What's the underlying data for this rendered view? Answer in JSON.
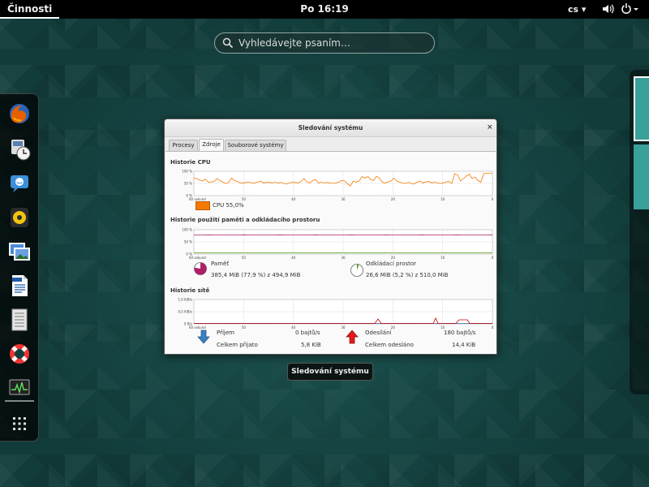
{
  "topbar": {
    "activities": "Činnosti",
    "clock": "Po 16:19",
    "language": "cs ▾",
    "volume_icon": "volume-icon",
    "power_icon": "power-icon"
  },
  "search": {
    "placeholder": "Vyhledávejte psaním…"
  },
  "dash": {
    "apps": [
      {
        "name": "firefox-icon"
      },
      {
        "name": "clock-app-icon"
      },
      {
        "name": "chat-app-icon"
      },
      {
        "name": "music-app-icon"
      },
      {
        "name": "photos-app-icon"
      },
      {
        "name": "writer-doc-icon"
      },
      {
        "name": "archive-app-icon"
      },
      {
        "name": "help-lifebuoy-icon"
      },
      {
        "name": "system-monitor-icon"
      },
      {
        "name": "show-apps-grid-icon"
      }
    ]
  },
  "window": {
    "title": "Sledování systému",
    "close": "×",
    "tabs": [
      "Procesy",
      "Zdroje",
      "Souborové systémy"
    ],
    "active_tab": "Zdroje",
    "cpu": {
      "title": "Historie CPU",
      "y_ticks": [
        "100 %",
        "50 %",
        "0 %"
      ],
      "x_ticks": [
        "60 sekund",
        "50",
        "40",
        "30",
        "20",
        "10",
        "0"
      ],
      "legend": "CPU  55,0%",
      "color": "#f57900",
      "values": [
        72,
        70,
        64,
        60,
        68,
        55,
        56,
        58,
        70,
        62,
        55,
        50,
        54,
        72,
        62,
        58,
        52,
        52,
        54,
        55,
        52,
        52,
        55,
        60,
        52,
        54,
        54,
        52,
        55,
        52,
        54,
        50,
        48,
        52,
        55,
        54,
        52,
        58,
        70,
        56,
        52,
        62,
        66,
        52,
        55,
        52,
        54,
        52,
        50,
        52,
        55,
        62,
        60,
        48,
        40,
        60,
        55,
        60,
        78,
        72,
        78,
        66,
        62,
        80,
        72,
        55,
        52,
        56,
        60,
        72,
        60,
        55,
        52,
        50,
        54,
        50,
        48,
        55,
        60,
        52,
        56,
        58,
        52,
        55,
        52,
        50,
        52,
        56,
        58,
        50,
        90,
        85,
        60,
        70,
        80,
        88,
        70,
        76,
        62,
        55,
        90,
        92,
        92,
        90
      ]
    },
    "memory": {
      "title": "Historie použití paměti a odkládacího prostoru",
      "y_ticks": [
        "100 %",
        "50 %",
        "0 %"
      ],
      "x_ticks": [
        "60 sekund",
        "50",
        "40",
        "30",
        "20",
        "10",
        "0"
      ],
      "mem_label": "Paměť",
      "mem_value": "385,4 MiB (77,9 %) z 494,9 MiB",
      "mem_color": "#ad1f67",
      "mem_percent": 77.9,
      "swap_label": "Odkládací prostor",
      "swap_value": "26,6 MiB (5,2 %) z 510,0 MiB",
      "swap_color": "#4e9a06",
      "swap_percent": 5.2
    },
    "network": {
      "title": "Historie sítě",
      "y_ticks": [
        "1,0 KiB/s",
        "0,5 KiB/s",
        "0 B/s"
      ],
      "x_ticks": [
        "60 sekund",
        "50",
        "40",
        "30",
        "20",
        "10",
        "0"
      ],
      "rx_label": "Příjem",
      "rx_value": "0 bajtů/s",
      "rx_total_label": "Celkem přijato",
      "rx_total": "5,8 KiB",
      "rx_color": "#3465a4",
      "tx_label": "Odesílání",
      "tx_value": "180 bajtů/s",
      "tx_total_label": "Celkem odesláno",
      "tx_total": "14,4 KiB",
      "tx_color": "#cc0000"
    }
  },
  "tooltip": "Sledování systému"
}
